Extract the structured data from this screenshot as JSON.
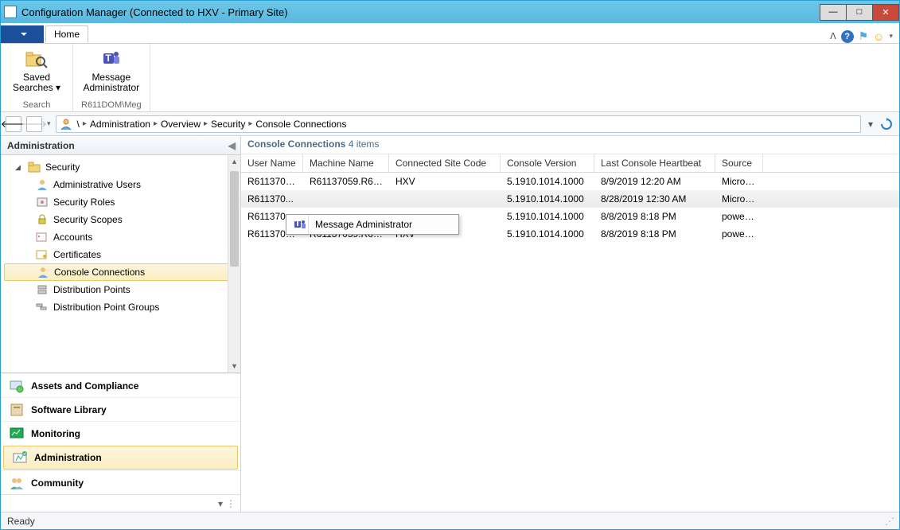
{
  "window": {
    "title": "Configuration Manager (Connected to HXV -  Primary Site)"
  },
  "tabs": {
    "file_dropdown": "▾",
    "home": "Home"
  },
  "ribbon": {
    "saved_searches": "Saved\nSearches ▾",
    "search_group": "Search",
    "message_admin": "Message\nAdministrator",
    "user_group": "R611DOM\\Meg"
  },
  "breadcrumb": {
    "items": [
      "\\",
      "Administration",
      "Overview",
      "Security",
      "Console Connections"
    ]
  },
  "nav": {
    "header": "Administration",
    "tree": {
      "security": "Security",
      "admin_users": "Administrative Users",
      "security_roles": "Security Roles",
      "security_scopes": "Security Scopes",
      "accounts": "Accounts",
      "certificates": "Certificates",
      "console_connections": "Console Connections",
      "dist_points": "Distribution Points",
      "dist_point_groups": "Distribution Point Groups"
    },
    "workspaces": {
      "assets": "Assets and Compliance",
      "software": "Software Library",
      "monitoring": "Monitoring",
      "administration": "Administration",
      "community": "Community"
    }
  },
  "grid": {
    "title_prefix": "Console Connections ",
    "title_count": "4 items",
    "columns": [
      "User Name",
      "Machine Name",
      "Connected Site Code",
      "Console Version",
      "Last Console Heartbeat",
      "Source"
    ],
    "rows": [
      {
        "user": "R6113705...",
        "machine": "R61137059.R61...",
        "site": "HXV",
        "ver": "5.1910.1014.1000",
        "hb": "8/9/2019 12:20 AM",
        "src": "Micros..."
      },
      {
        "user": "R611370...",
        "machine": "",
        "site": "",
        "ver": "5.1910.1014.1000",
        "hb": "8/28/2019 12:30 AM",
        "src": "Micros..."
      },
      {
        "user": "R611370...",
        "machine": "",
        "site": "",
        "ver": "5.1910.1014.1000",
        "hb": "8/8/2019 8:18 PM",
        "src": "powers..."
      },
      {
        "user": "R6113705...",
        "machine": "R61137059.R61...",
        "site": "HXV",
        "ver": "5.1910.1014.1000",
        "hb": "8/8/2019 8:18 PM",
        "src": "powers..."
      }
    ]
  },
  "context_menu": {
    "item": "Message Administrator"
  },
  "status": "Ready"
}
